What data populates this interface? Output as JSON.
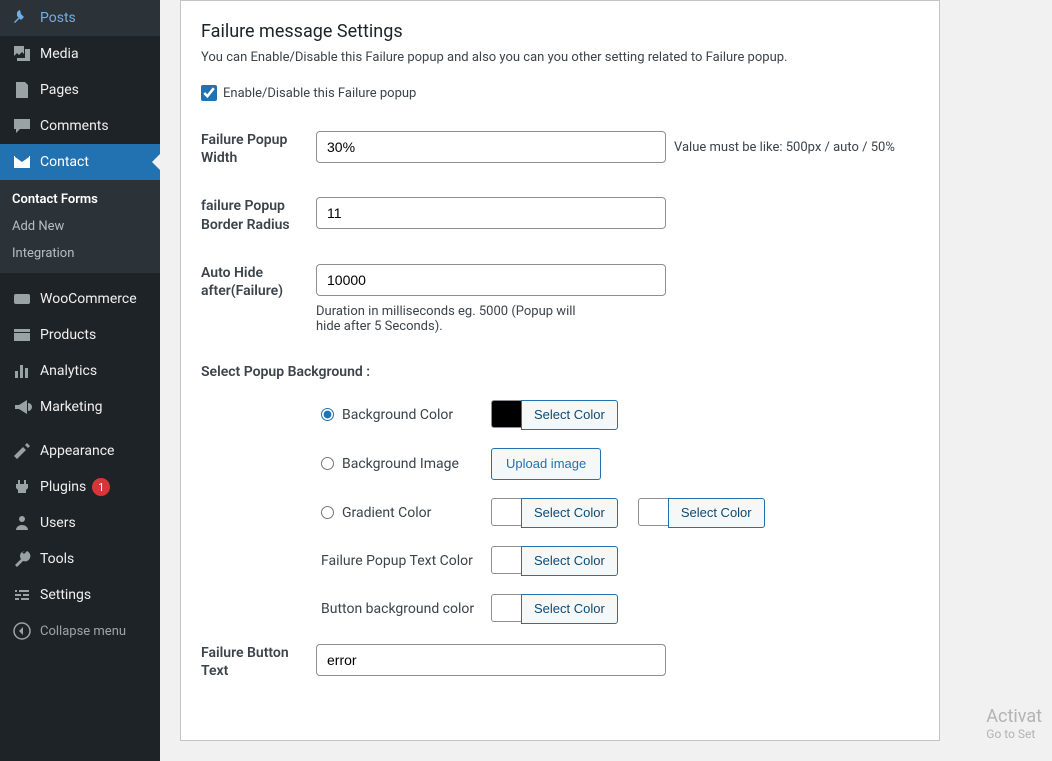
{
  "sidebar": {
    "items": [
      {
        "label": "Posts",
        "icon": "pin"
      },
      {
        "label": "Media",
        "icon": "media"
      },
      {
        "label": "Pages",
        "icon": "pages"
      },
      {
        "label": "Comments",
        "icon": "comments"
      },
      {
        "label": "Contact",
        "icon": "mail",
        "active": true
      },
      {
        "label": "WooCommerce",
        "icon": "woo"
      },
      {
        "label": "Products",
        "icon": "products"
      },
      {
        "label": "Analytics",
        "icon": "analytics"
      },
      {
        "label": "Marketing",
        "icon": "marketing"
      },
      {
        "label": "Appearance",
        "icon": "appearance"
      },
      {
        "label": "Plugins",
        "icon": "plugins",
        "badge": "1"
      },
      {
        "label": "Users",
        "icon": "users"
      },
      {
        "label": "Tools",
        "icon": "tools"
      },
      {
        "label": "Settings",
        "icon": "settings"
      },
      {
        "label": "Collapse menu",
        "icon": "collapse"
      }
    ],
    "submenu": [
      {
        "label": "Contact Forms",
        "current": true
      },
      {
        "label": "Add New"
      },
      {
        "label": "Integration"
      }
    ]
  },
  "page": {
    "title": "Failure message Settings",
    "description": "You can Enable/Disable this Failure popup and also you can you other setting related to Failure popup.",
    "enable_label": "Enable/Disable this Failure popup",
    "enable_checked": true,
    "fields": {
      "width_label": "Failure Popup Width",
      "width_value": "30%",
      "width_hint": "Value must be like: 500px / auto / 50%",
      "radius_label": "failure Popup Border Radius",
      "radius_value": "11",
      "autohide_label": "Auto Hide after(Failure)",
      "autohide_value": "10000",
      "autohide_hint": "Duration in milliseconds eg. 5000 (Popup will hide after 5 Seconds).",
      "bg_section_label": "Select Popup Background :",
      "bg_color_label": "Background Color",
      "bg_image_label": "Background Image",
      "gradient_label": "Gradient Color",
      "text_color_label": "Failure Popup Text Color",
      "button_bg_label": "Button background color",
      "select_color": "Select Color",
      "upload_image": "Upload image",
      "button_text_label": "Failure Button Text",
      "button_text_value": "error"
    }
  },
  "watermark": {
    "title": "Activat",
    "sub": "Go to Set"
  }
}
